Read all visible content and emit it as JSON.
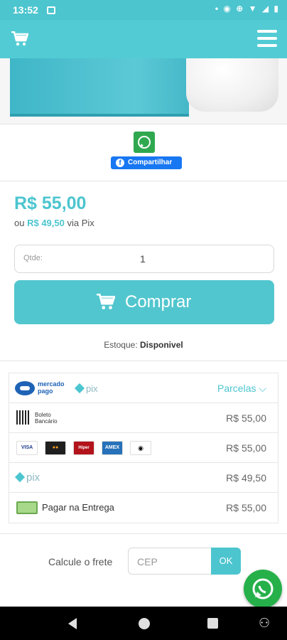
{
  "status_bar": {
    "time": "13:52",
    "right_icons": "• ◉ ⊕ ▼ ◢ ▮"
  },
  "header": {
    "cart_icon": "cart-icon",
    "menu_icon": "hamburger-icon"
  },
  "share": {
    "whatsapp_icon": "whatsapp-icon",
    "facebook_label": "Compartilhar"
  },
  "product": {
    "price": "R$ 55,00",
    "pix_prefix": "ou",
    "pix_price": "R$ 49,50",
    "pix_suffix": "via Pix",
    "qty_label": "Qtde:",
    "qty_value": "1",
    "buy_label": "Comprar",
    "stock_label": "Estoque:",
    "stock_value": "Disponivel"
  },
  "payment": {
    "header": {
      "mp_label_1": "mercado",
      "mp_label_2": "pago",
      "pix_label": "pix",
      "parcelas_label": "Parcelas"
    },
    "rows": [
      {
        "name": "Boleto Bancário",
        "label_1": "Boleto",
        "label_2": "Bancário",
        "amount": "R$ 55,00"
      },
      {
        "name": "Cartões",
        "cards": [
          "VISA",
          "MC",
          "Hipercard",
          "AMEX",
          "Elo"
        ],
        "amount": "R$ 55,00"
      },
      {
        "name": "Pix",
        "label": "pix",
        "amount": "R$ 49,50"
      },
      {
        "name": "Pagar na Entrega",
        "label": "Pagar na Entrega",
        "amount": "R$ 55,00"
      }
    ]
  },
  "freight": {
    "label": "Calcule o frete",
    "placeholder": "CEP",
    "ok_label": "OK"
  },
  "colors": {
    "accent": "#4cc5cf",
    "whatsapp": "#26b04a",
    "facebook": "#1877f2"
  }
}
